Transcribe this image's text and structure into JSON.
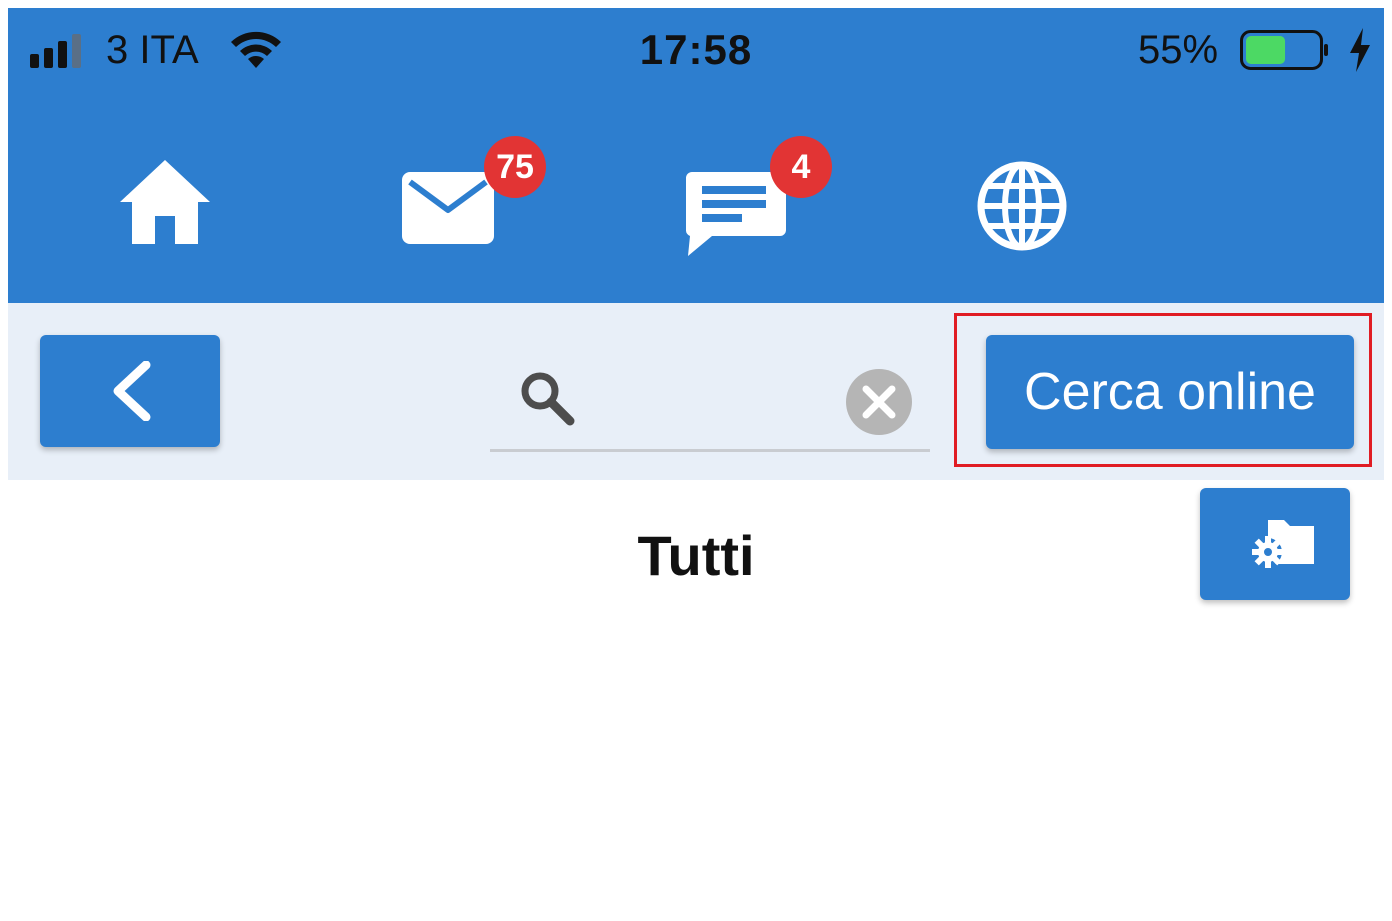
{
  "status_bar": {
    "carrier": "3 ITA",
    "time": "17:58",
    "battery_percent": "55%",
    "battery_level": 0.55,
    "charging": true,
    "icons": [
      "signal-icon",
      "wifi-icon",
      "battery-icon",
      "charging-bolt-icon"
    ]
  },
  "nav": {
    "items": [
      {
        "name": "home",
        "icon": "home-icon"
      },
      {
        "name": "mail",
        "icon": "mail-icon",
        "badge": "75"
      },
      {
        "name": "chat",
        "icon": "chat-icon",
        "badge": "4"
      },
      {
        "name": "web",
        "icon": "globe-icon"
      }
    ]
  },
  "toolbar": {
    "back_icon": "chevron-left-icon",
    "search": {
      "value": "",
      "placeholder": ""
    },
    "search_online_label": "Cerca online"
  },
  "content": {
    "title": "Tutti",
    "settings_icon": "folder-settings-icon"
  },
  "colors": {
    "primary": "#2d7ecf",
    "badge": "#e23434",
    "highlight": "#e01c24",
    "toolbar_bg": "#e8eff8"
  }
}
